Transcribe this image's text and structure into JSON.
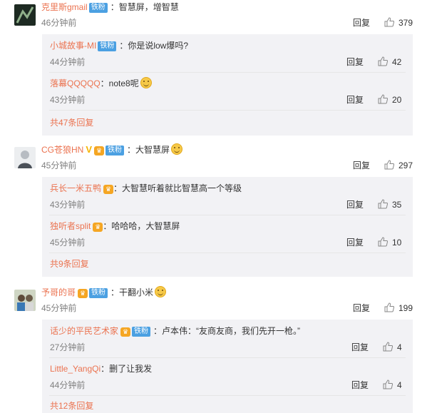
{
  "threads": [
    {
      "user": "克里斯gmail",
      "badge": "铁粉",
      "text": "：智慧屏，增智慧",
      "time": "46分钟前",
      "reply_label": "回复",
      "likes": "379",
      "replies": [
        {
          "user": "小城故事-MI",
          "badge": "铁粉",
          "text": "：你是说low爆吗?",
          "time": "44分钟前",
          "reply_label": "回复",
          "likes": "42"
        },
        {
          "user": "落幕QQQQQ",
          "text": "：note8呢",
          "time": "43分钟前",
          "reply_label": "回复",
          "likes": "20"
        }
      ],
      "more": "共47条回复"
    },
    {
      "user": "CG苍狼HN",
      "badge": "铁粉",
      "text": "：大智慧屏",
      "time": "45分钟前",
      "reply_label": "回复",
      "likes": "297",
      "replies": [
        {
          "user": "兵长一米五鸭",
          "text": "：大智慧听着就比智慧高一个等级",
          "time": "43分钟前",
          "reply_label": "回复",
          "likes": "35"
        },
        {
          "user": "独听者split",
          "text": "：哈哈哈，大智慧屏",
          "time": "45分钟前",
          "reply_label": "回复",
          "likes": "10"
        }
      ],
      "more": "共9条回复"
    },
    {
      "user": "予哥的哥",
      "badge": "铁粉",
      "text": "：干翻小米",
      "time": "45分钟前",
      "reply_label": "回复",
      "likes": "199",
      "replies": [
        {
          "user": "话少的平民艺术家",
          "badge": "铁粉",
          "text": "：卢本伟：“友商友商，我们先开一枪。”",
          "time": "27分钟前",
          "reply_label": "回复",
          "likes": "4"
        },
        {
          "user": "Little_YangQi",
          "text": "：删了让我发",
          "time": "44分钟前",
          "reply_label": "回复",
          "likes": "4"
        }
      ],
      "more": "共12条回复"
    }
  ],
  "colors": {
    "username": "#eb7350",
    "fan_badge": "#4ba0e2",
    "meta": "#808080",
    "reply_bg": "#f2f2f5"
  },
  "icons": {
    "like": "thumbs-up-icon",
    "vip": "vip-crown-icon",
    "verified": "v-verified-icon",
    "emoji": "smile-emoji-icon"
  }
}
